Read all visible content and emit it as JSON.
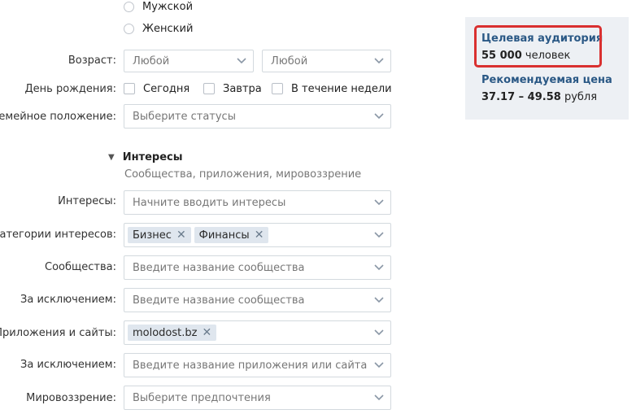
{
  "gender": {
    "options": [
      "Мужской",
      "Женский"
    ]
  },
  "age": {
    "label": "Возраст:",
    "from": "Любой",
    "to": "Любой"
  },
  "birthday": {
    "label": "День рождения:",
    "options": [
      "Сегодня",
      "Завтра",
      "В течение недели"
    ]
  },
  "marital": {
    "label": "Семейное положение:",
    "placeholder": "Выберите статусы"
  },
  "interests_section": {
    "title": "Интересы",
    "subtitle": "Сообщества, приложения, мировоззрение"
  },
  "fields": {
    "interests": {
      "label": "Интересы:",
      "placeholder": "Начните вводить интересы"
    },
    "categories": {
      "label": "Категории интересов:",
      "tags": [
        "Бизнес",
        "Финансы"
      ]
    },
    "communities": {
      "label": "Сообщества:",
      "placeholder": "Введите название сообщества"
    },
    "communities_except": {
      "label": "За исключением:",
      "placeholder": "Введите название сообщества"
    },
    "apps": {
      "label": "Приложения и сайты:",
      "tags": [
        "molodost.bz"
      ]
    },
    "apps_except": {
      "label": "За исключением:",
      "placeholder": "Введите название приложения или сайта"
    },
    "worldview": {
      "label": "Мировоззрение:",
      "placeholder": "Выберите предпочтения"
    }
  },
  "sidebar": {
    "audience_title": "Целевая аудитория",
    "audience_value": "55 000",
    "audience_unit": "человек",
    "price_title": "Рекомендуемая цена",
    "price_value": "37.17 – 49.58",
    "price_unit": "рубля"
  },
  "colors": {
    "link": "#2a5885",
    "highlight": "#d93030",
    "sidebar_bg": "#edf0f4",
    "tag_bg": "#dfe6ee"
  }
}
